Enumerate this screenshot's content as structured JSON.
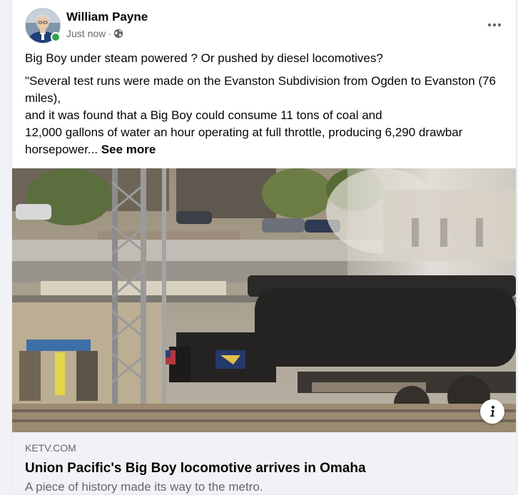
{
  "post": {
    "author": "William Payne",
    "timestamp": "Just now",
    "separator": "·",
    "audience_icon": "globe-icon",
    "more_icon": "more-options-icon",
    "avatar_status": "online",
    "text": {
      "line1": "Big Boy under steam powered ? Or pushed by diesel locomotives?",
      "line2": "\"Several test runs were made on the Evanston Subdivision from Ogden to Evanston (76 miles),",
      "line3": "and it was found that a Big Boy could consume 11 tons of coal and",
      "line4": "12,000 gallons of water an hour operating at full throttle, producing 6,290 drawbar horsepower...",
      "see_more": "See more"
    }
  },
  "link_preview": {
    "domain": "KETV.COM",
    "title": "Union Pacific's Big Boy locomotive arrives in Omaha",
    "description": "A piece of history made its way to the metro.",
    "info_icon": "info-icon",
    "image_subject": "steam-locomotive-photo"
  },
  "colors": {
    "primary_text": "#050505",
    "secondary_text": "#65676b",
    "online_green": "#31a24c",
    "preview_bg": "#f0f2f5"
  }
}
